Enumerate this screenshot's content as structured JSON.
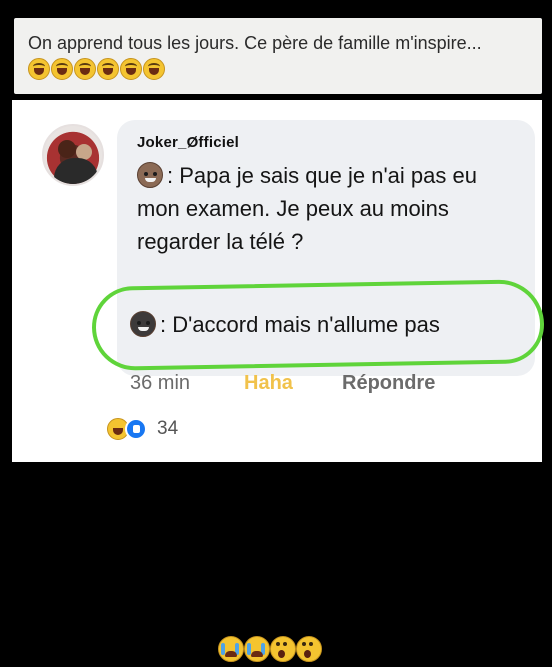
{
  "caption": {
    "text": "On apprend tous les jours. Ce père de famille m'inspire...",
    "emojis": [
      "laugh-emoji",
      "laugh-emoji",
      "laugh-emoji",
      "laugh-emoji",
      "laugh-emoji",
      "laugh-emoji"
    ]
  },
  "comment": {
    "author": "Joker_Øfficiel",
    "message1": ": Papa je sais que je n'ai pas eu mon examen. Je peux au moins regarder la télé ?",
    "message2": ": D'accord mais n'allume pas",
    "time": "36 min",
    "reaction_label": "Haha",
    "reply_label": "Répondre",
    "reaction_count": "34",
    "highlight_color": "#5fd43a"
  },
  "bottom_emojis": [
    "crying-emoji",
    "crying-emoji",
    "shocked-emoji",
    "shocked-emoji"
  ]
}
